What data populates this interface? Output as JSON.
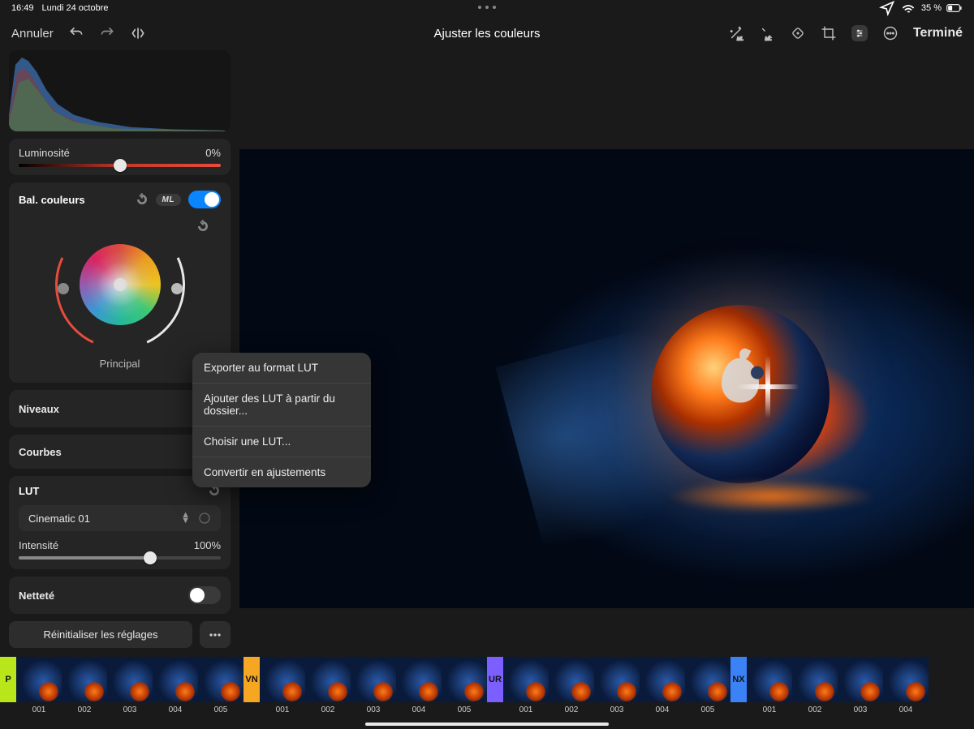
{
  "status": {
    "time": "16:49",
    "date": "Lundi 24 octobre",
    "battery": "35 %"
  },
  "toolbar": {
    "cancel": "Annuler",
    "title": "Ajuster les couleurs",
    "done": "Terminé"
  },
  "panels": {
    "luminosity": {
      "label": "Luminosité",
      "value": "0%"
    },
    "color_balance": {
      "title": "Bal. couleurs",
      "ml": "ML",
      "caption": "Principal"
    },
    "levels": {
      "title": "Niveaux"
    },
    "curves": {
      "title": "Courbes"
    },
    "lut": {
      "title": "LUT",
      "preset": "Cinematic 01",
      "intensity_label": "Intensité",
      "intensity_value": "100%"
    },
    "sharpness": {
      "title": "Netteté"
    }
  },
  "reset_button": "Réinitialiser les réglages",
  "popover": {
    "export": "Exporter au format LUT",
    "add_folder": "Ajouter des LUT à partir du dossier...",
    "choose": "Choisir une LUT...",
    "convert": "Convertir en ajustements"
  },
  "presets": [
    {
      "tag": "P",
      "cls": "preset-p"
    },
    {
      "label": "001"
    },
    {
      "label": "002"
    },
    {
      "label": "003"
    },
    {
      "label": "004"
    },
    {
      "label": "005"
    },
    {
      "tag": "VN",
      "cls": "preset-vn"
    },
    {
      "label": "001"
    },
    {
      "label": "002"
    },
    {
      "label": "003"
    },
    {
      "label": "004"
    },
    {
      "label": "005"
    },
    {
      "tag": "UR",
      "cls": "preset-ur"
    },
    {
      "label": "001"
    },
    {
      "label": "002"
    },
    {
      "label": "003"
    },
    {
      "label": "004"
    },
    {
      "label": "005"
    },
    {
      "tag": "NX",
      "cls": "preset-nx"
    },
    {
      "label": "001"
    },
    {
      "label": "002"
    },
    {
      "label": "003"
    },
    {
      "label": "004"
    }
  ]
}
